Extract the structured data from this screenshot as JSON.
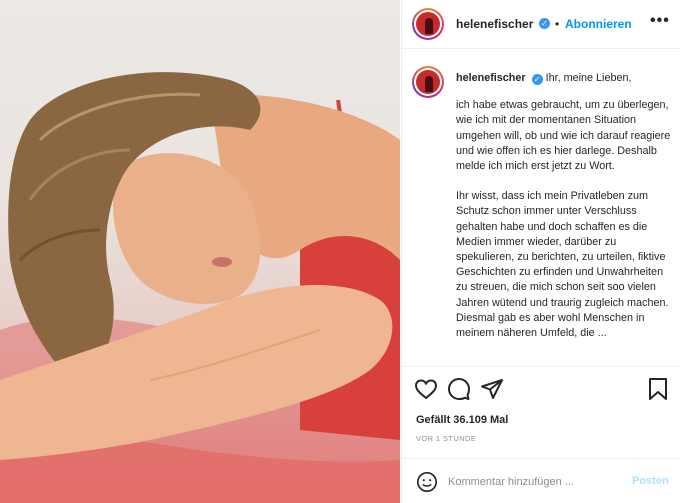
{
  "post": {
    "username": "helenefischer",
    "verified_mark": "✓",
    "separator": "•",
    "follow_label": "Abonnieren",
    "more_label": "•••",
    "caption_first": "Ihr, meine Lieben,",
    "caption_paragraphs": [
      "ich habe etwas gebraucht, um zu überlegen, wie ich mit der momentanen Situation umgehen will, ob und wie ich darauf reagiere und wie offen ich es hier darlege. Deshalb melde ich mich erst jetzt zu Wort.",
      "Ihr wisst, dass ich mein Privatleben zum Schutz schon immer unter Verschluss gehalten habe und doch schaffen es die Medien immer wieder, darüber zu spekulieren, zu berichten, zu urteilen, fiktive Geschichten zu erfinden und Unwahrheiten zu streuen, die mich schon seit soo vielen Jahren wütend und traurig zugleich machen. Diesmal gab es aber wohl Menschen in meinem näheren Umfeld, die ..."
    ],
    "likes_label": "Gefällt 36.109 Mal",
    "time_label": "VOR 1 STUNDE",
    "comment_placeholder": "Kommentar hinzufügen ...",
    "post_button": "Posten"
  },
  "icons": {
    "like": "heart-icon",
    "comment": "comment-icon",
    "share": "paper-plane-icon",
    "save": "bookmark-icon",
    "emoji": "smiley-icon"
  },
  "colors": {
    "accent": "#0095f6",
    "verified": "#3897f0",
    "post_disabled": "#b2dffc",
    "text": "#262626",
    "muted": "#8e8e8e"
  }
}
